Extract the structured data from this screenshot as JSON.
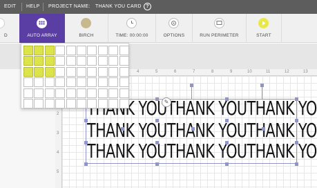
{
  "menubar": {
    "items": [
      "EDIT",
      "HELP"
    ],
    "project_label": "PROJECT NAME:",
    "project_name": "THANK YOU CARD",
    "help_icon": "?"
  },
  "toolbar": {
    "partial_label": "D",
    "auto_array": "AUTO ARRAY",
    "material": "BIRCH",
    "time": "TIME: 00:00:00",
    "options": "OPTIONS",
    "run_perimeter": "RUN PERIMETER",
    "start": "START"
  },
  "array_picker": {
    "columns": 10,
    "rows": 6,
    "selected_columns": 3,
    "selected_rows": 3,
    "highlight_color": "#dde34a"
  },
  "ruler": {
    "top": [
      "4",
      "5",
      "6",
      "7",
      "8",
      "9",
      "10",
      "11",
      "12",
      "13"
    ],
    "left": [
      "2",
      "3",
      "4",
      "5"
    ]
  },
  "canvas": {
    "rows": [
      "THANK YOUTHANK YOUTHANK YOU",
      "THANK YOUTHANK YOUTHANK YOU",
      "THANK YOUTHANK YOUTHANK YOU"
    ]
  },
  "colors": {
    "menubar": "#5d5d5d",
    "active_tool": "#5b3ea3",
    "material_swatch": "#c8b88c",
    "start_button": "#e8e84a",
    "selection": "#8f95c9"
  }
}
